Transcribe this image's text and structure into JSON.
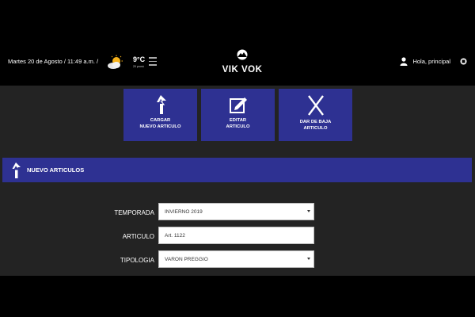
{
  "header": {
    "datetime": "Martes 20 de Agosto / 11:49 a.m. /",
    "temperature": "9°C",
    "temperature_sub": "20 pronó",
    "logo_text": "VIK VOK",
    "greeting": "Hola, principal"
  },
  "tiles": [
    {
      "label": "CARGAR\nNUEVO ARTICULO",
      "icon": "double-up-arrow-icon"
    },
    {
      "label": "EDITAR\nARTICULO",
      "icon": "edit-icon"
    },
    {
      "label": "DAR DE BAJA\nARTICULO",
      "icon": "x-icon"
    }
  ],
  "section": {
    "title": "NUEVO ARTICULOS"
  },
  "form": {
    "temporada": {
      "label": "TEMPORADA",
      "value": "INVIERNO 2019"
    },
    "articulo": {
      "label": "ARTICULO",
      "value": "Art. 1122"
    },
    "tipologia": {
      "label": "TIPOLOGIA",
      "value": "VARON PREGGIO"
    }
  },
  "colors": {
    "accent": "#2e3192",
    "background": "#000000",
    "panel": "#232323"
  }
}
